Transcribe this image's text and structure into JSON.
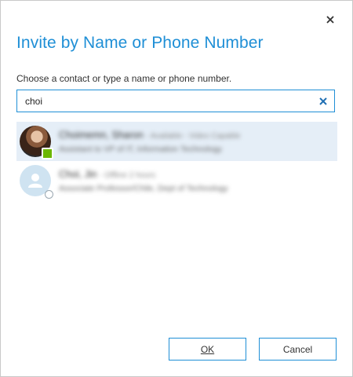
{
  "dialog": {
    "title": "Invite by Name or Phone Number",
    "instruction": "Choose a contact or type a name or phone number.",
    "close_icon": "close-icon"
  },
  "search": {
    "value": "choi",
    "clear_icon": "clear-icon"
  },
  "results": [
    {
      "name": "Choimemn, Sharon",
      "name_extra": "- Available - Video Capable",
      "detail": "Assistant to VP of IT, Information Technology",
      "presence": "available",
      "selected": true,
      "avatar": "photo"
    },
    {
      "name": "Choi, Jin",
      "name_extra": "- Offline 2 hours",
      "detail": "Associate Professor/Chile, Dept of Technology",
      "presence": "unknown",
      "selected": false,
      "avatar": "default-person-icon"
    }
  ],
  "buttons": {
    "ok": "OK",
    "cancel": "Cancel"
  },
  "colors": {
    "accent": "#1f8fd6",
    "selected_row": "#e5eef7",
    "available": "#6bb700"
  }
}
